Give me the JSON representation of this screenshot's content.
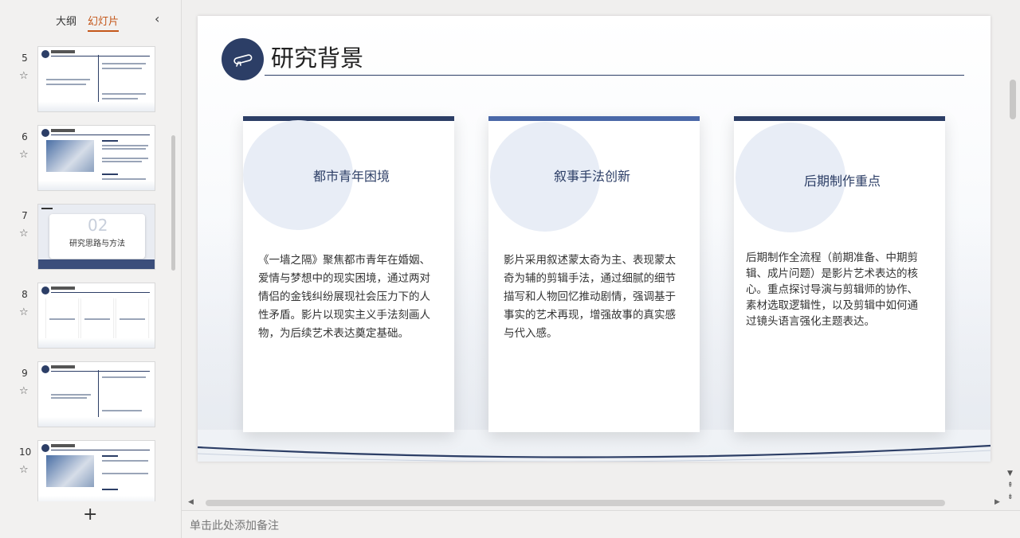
{
  "left_panel": {
    "tabs": [
      {
        "label": "大纲",
        "active": false
      },
      {
        "label": "幻灯片",
        "active": true
      }
    ],
    "collapse_icon": "chevron-left-icon",
    "slides": [
      {
        "number": "5"
      },
      {
        "number": "6"
      },
      {
        "number": "7",
        "label": "研究思路与方法",
        "big_number": "02"
      },
      {
        "number": "8"
      },
      {
        "number": "9"
      },
      {
        "number": "10"
      }
    ],
    "add_icon": "plus-icon"
  },
  "slide": {
    "title": "研究背景",
    "icon": "scroll-diploma-icon",
    "cards": [
      {
        "title": "都市青年困境",
        "body": "《一墙之隔》聚焦都市青年在婚姻、爱情与梦想中的现实困境，通过两对情侣的金钱纠纷展现社会压力下的人性矛盾。影片以现实主义手法刻画人物，为后续艺术表达奠定基础。"
      },
      {
        "title": "叙事手法创新",
        "body": "影片采用叙述蒙太奇为主、表现蒙太奇为辅的剪辑手法，通过细腻的细节描写和人物回忆推动剧情，强调基于事实的艺术再现，增强故事的真实感与代入感。"
      },
      {
        "title": "后期制作重点",
        "body": "后期制作全流程（前期准备、中期剪辑、成片问题）是影片艺术表达的核心。重点探讨导演与剪辑师的协作、素材选取逻辑性，以及剪辑中如何通过镜头语言强化主题表达。"
      }
    ]
  },
  "notes": {
    "placeholder": "单击此处添加备注"
  },
  "colors": {
    "accent": "#c4571a",
    "navy": "#2c3e66"
  }
}
